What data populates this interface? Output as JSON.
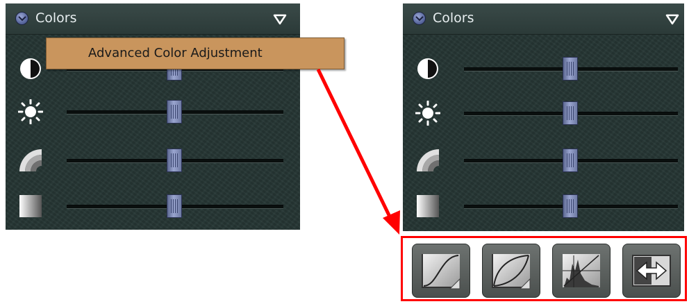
{
  "left_panel": {
    "title": "Colors",
    "tooltip": "Advanced Color Adjustment",
    "sliders": [
      {
        "name": "contrast",
        "icon": "contrast-icon",
        "value": 0.5
      },
      {
        "name": "brightness",
        "icon": "brightness-icon",
        "value": 0.5
      },
      {
        "name": "gamma",
        "icon": "gamma-icon",
        "value": 0.5
      },
      {
        "name": "saturation",
        "icon": "gradient-icon",
        "value": 0.5
      }
    ]
  },
  "right_panel": {
    "title": "Colors",
    "sliders": [
      {
        "name": "contrast",
        "icon": "contrast-icon",
        "value": 0.5
      },
      {
        "name": "brightness",
        "icon": "brightness-icon",
        "value": 0.5
      },
      {
        "name": "gamma",
        "icon": "gamma-icon",
        "value": 0.5
      },
      {
        "name": "saturation",
        "icon": "gradient-icon",
        "value": 0.5
      }
    ],
    "advanced_buttons": [
      {
        "icon": "s-curve-icon"
      },
      {
        "icon": "curve-icon"
      },
      {
        "icon": "histogram-icon"
      },
      {
        "icon": "swap-arrows-icon"
      }
    ]
  },
  "colors": {
    "panel_bg": "#253533",
    "tooltip_bg": "#c9955d",
    "highlight": "#ff0000"
  }
}
